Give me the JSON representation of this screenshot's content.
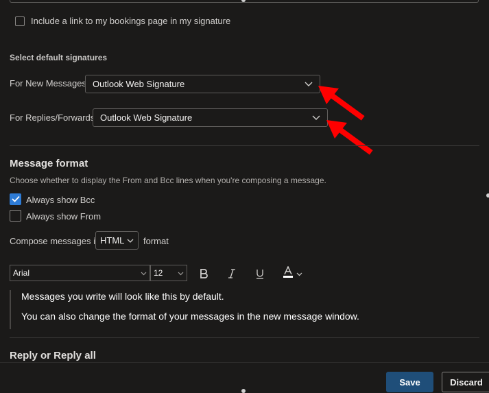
{
  "bookings": {
    "label": "Include a link to my bookings page in my signature"
  },
  "signatures": {
    "heading": "Select default signatures",
    "new_messages_label": "For New Messages:",
    "new_messages_value": "Outlook Web Signature",
    "replies_label": "For Replies/Forwards:",
    "replies_value": "Outlook Web Signature"
  },
  "message_format": {
    "heading": "Message format",
    "description": "Choose whether to display the From and Bcc lines when you're composing a message.",
    "always_bcc_label": "Always show Bcc",
    "always_bcc_checked": true,
    "always_from_label": "Always show From",
    "always_from_checked": false,
    "compose_prefix": "Compose messages in",
    "compose_value": "HTML",
    "compose_suffix": "format"
  },
  "toolbar": {
    "font": "Arial",
    "size": "12",
    "bold_icon": "bold-icon",
    "italic_icon": "italic-icon",
    "underline_icon": "underline-icon",
    "font_color_icon": "font-color-icon"
  },
  "preview": {
    "line1": "Messages you write will look like this by default.",
    "line2": "You can also change the format of your messages in the new message window."
  },
  "reply": {
    "heading": "Reply or Reply all"
  },
  "footer": {
    "save_label": "Save",
    "discard_label": "Discard"
  },
  "annotations": {
    "arrow_color": "#ff0000"
  },
  "colors": {
    "accent": "#2e7cd6",
    "save_bg": "#1f4e79"
  }
}
